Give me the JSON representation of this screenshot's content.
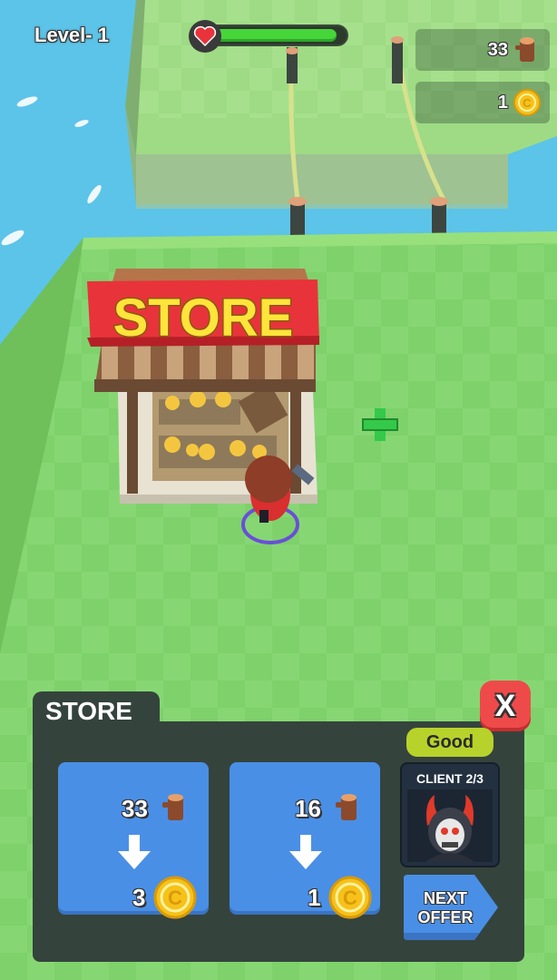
{
  "hud": {
    "level_label": "Level- 1",
    "health_fraction": 0.95,
    "wood_count": "33",
    "coin_count": "1",
    "icons": {
      "health": "heart-icon",
      "wood": "wood-log-icon",
      "coin": "coin-icon"
    }
  },
  "world": {
    "store_sign": "STORE",
    "marker": "green-plus-marker"
  },
  "store_panel": {
    "title": "STORE",
    "close_label": "X",
    "rating": "Good",
    "client_label": "CLIENT 2/3",
    "next_offer_label": "NEXT OFFER",
    "offers": [
      {
        "wood": "33",
        "coins": "3"
      },
      {
        "wood": "16",
        "coins": "1"
      }
    ],
    "icons": {
      "wood": "wood-log-icon",
      "coin": "coin-icon",
      "arrow": "arrow-down-icon"
    }
  },
  "colors": {
    "grass": "#7fd26c",
    "water": "#5cc4e8",
    "panel": "#35433d",
    "offer_blue": "#4a8fe6",
    "close_red": "#ef4a4a",
    "rating_green": "#b8d22c",
    "sign_red": "#e8333b",
    "sign_text": "#ffe43b"
  }
}
